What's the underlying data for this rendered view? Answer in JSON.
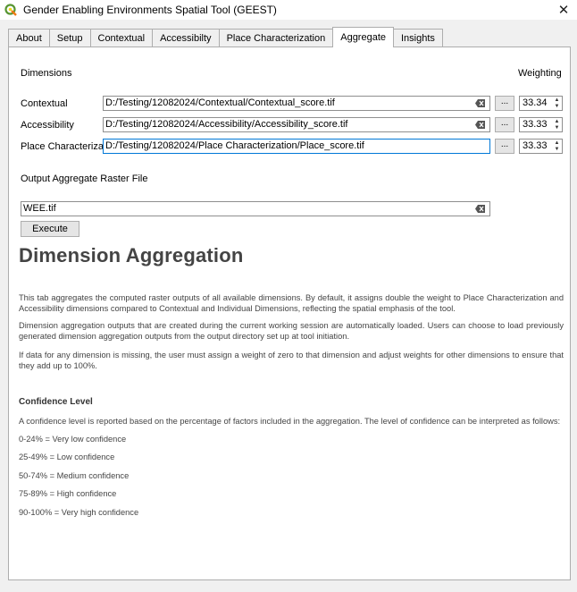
{
  "window": {
    "title": "Gender Enabling Environments Spatial Tool (GEEST)",
    "close_glyph": "✕"
  },
  "tabs": [
    {
      "label": "About"
    },
    {
      "label": "Setup"
    },
    {
      "label": "Contextual"
    },
    {
      "label": "Accessibilty"
    },
    {
      "label": "Place Characterization"
    },
    {
      "label": "Aggregate"
    },
    {
      "label": "Insights"
    }
  ],
  "active_tab": "Aggregate",
  "form": {
    "dimensions_header": "Dimensions",
    "weighting_header": "Weighting",
    "rows": [
      {
        "label": "Contextual",
        "path": "D:/Testing/12082024/Contextual/Contextual_score.tif",
        "browse_label": "...",
        "weight": "33.34"
      },
      {
        "label": "Accessibility",
        "path": "D:/Testing/12082024/Accessibility/Accessibility_score.tif",
        "browse_label": "...",
        "weight": "33.33"
      },
      {
        "label": "Place Characterization",
        "path": "D:/Testing/12082024/Place Characterization/Place_score.tif",
        "browse_label": "...",
        "weight": "33.33"
      }
    ],
    "output_label": "Output Aggregate Raster File",
    "output_value": "WEE.tif",
    "execute_label": "Execute"
  },
  "help": {
    "heading": "Dimension Aggregation",
    "paragraphs": [
      "This tab aggregates the computed raster outputs of all available dimensions. By default, it assigns double the weight to Place Characterization and Accessibility dimensions compared to Contextual and Individual Dimensions, reflecting the spatial emphasis of the tool.",
      "Dimension aggregation outputs that are created during the current working session are automatically loaded. Users can choose to load previously generated dimension aggregation outputs from the output directory set up at tool initiation.",
      "If data for any dimension is missing, the user must assign a weight of zero to that dimension and adjust weights for other dimensions to ensure that they add up to 100%."
    ],
    "confidence_title": "Confidence Level",
    "confidence_intro": "A confidence level is reported based on the percentage of factors included in the aggregation. The level of confidence can be interpreted as follows:",
    "confidence_levels": [
      "0-24% = Very low confidence",
      "25-49% = Low confidence",
      "50-74% = Medium confidence",
      "75-89% = High confidence",
      "90-100% = Very high confidence"
    ]
  },
  "icons": {
    "app": "qgis-icon",
    "clear": "clear-field-icon",
    "spin_up": "▲",
    "spin_down": "▼"
  },
  "colors": {
    "focus_border": "#0078d7",
    "app_icon": "#589632"
  }
}
